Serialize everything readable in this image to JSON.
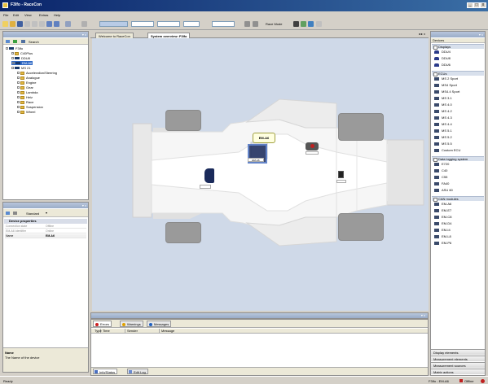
{
  "window": {
    "title": "F3Ifo - RaceCon"
  },
  "menu": [
    "File",
    "Edit",
    "View",
    "Extras",
    "Help"
  ],
  "toolbar": {
    "fields": [
      "",
      "",
      "",
      "",
      ""
    ],
    "race_mode_label": "Race Mode"
  },
  "left_panel": {
    "title": "",
    "search_label": "Search",
    "tree": [
      {
        "label": "F3Ifo",
        "kind": "project",
        "indent": 0
      },
      {
        "label": "C40Plus",
        "kind": "folder",
        "indent": 1
      },
      {
        "label": "DDU8",
        "kind": "ecu",
        "indent": 1
      },
      {
        "label": "EM-A6",
        "kind": "ecu",
        "indent": 1,
        "selected": true
      },
      {
        "label": "MS 21",
        "kind": "ecu",
        "indent": 1
      },
      {
        "label": "Acceleration/Steering",
        "kind": "folder",
        "indent": 2
      },
      {
        "label": "Analogue",
        "kind": "folder",
        "indent": 2
      },
      {
        "label": "Engine",
        "kind": "folder",
        "indent": 2
      },
      {
        "label": "Gear",
        "kind": "folder",
        "indent": 2
      },
      {
        "label": "Lambda",
        "kind": "folder",
        "indent": 2
      },
      {
        "label": "Heiz",
        "kind": "folder",
        "indent": 2
      },
      {
        "label": "Race",
        "kind": "folder",
        "indent": 2
      },
      {
        "label": "Suspension",
        "kind": "folder",
        "indent": 2
      },
      {
        "label": "Wheel",
        "kind": "folder",
        "indent": 2
      }
    ]
  },
  "properties": {
    "title": "",
    "filter_label": "Standard",
    "section": "Device properties",
    "rows": [
      {
        "key": "Connection state",
        "value": "Offline"
      },
      {
        "key": "EM-A6 Identifier",
        "value": "Online"
      },
      {
        "key": "Name",
        "value": "EM-A6"
      }
    ],
    "desc_title": "Name",
    "desc_text": "The Name of the device"
  },
  "main": {
    "tabs": [
      "Welcome to RaceCon",
      "System overview: F3Ifo"
    ],
    "active_tab": 1,
    "car": {
      "selected_callout": "EM-A6",
      "device_tag": "EM-A6"
    }
  },
  "bottom": {
    "tabs": [
      {
        "label": "Errors",
        "color": "#cc2020"
      },
      {
        "label": "Warnings",
        "color": "#e0a000"
      },
      {
        "label": "Messages",
        "color": "#2060c0"
      }
    ],
    "columns": [
      "Type",
      "Time",
      "Sender",
      "Message"
    ],
    "footer_tabs": [
      "Info/Status",
      "Edit Log"
    ]
  },
  "right_panel": {
    "title": "",
    "header": "Devices",
    "groups": [
      {
        "label": "Displays",
        "items": [
          "DDU4",
          "DDU8",
          "DDU6"
        ]
      },
      {
        "label": "ECUs",
        "items": [
          "MS 2 Sport",
          "MS4 Sport",
          "MS4.4 Sport",
          "MS 3.1",
          "MS 4.0",
          "MS 4.2",
          "MS 4.3",
          "MS 4.4",
          "MS 5.1",
          "MS 5.2",
          "MS 5.5",
          "Custom ECU"
        ]
      },
      {
        "label": "Data logging system",
        "items": [
          "E720",
          "C40",
          "C55",
          "FA40",
          "ASU 60"
        ]
      },
      {
        "label": "CAN modules",
        "items": [
          "EM-A6",
          "EM-E7",
          "EM-C8",
          "EM-D4",
          "EM-I4",
          "EM-L8",
          "EM-P6"
        ]
      }
    ],
    "accordion": [
      "Display elements",
      "Measurement elements",
      "Measurement sources",
      "Matrix actions"
    ]
  },
  "status": {
    "left": "Ready",
    "right": "F3Ifo - EM-A6",
    "mode": "Offline"
  }
}
